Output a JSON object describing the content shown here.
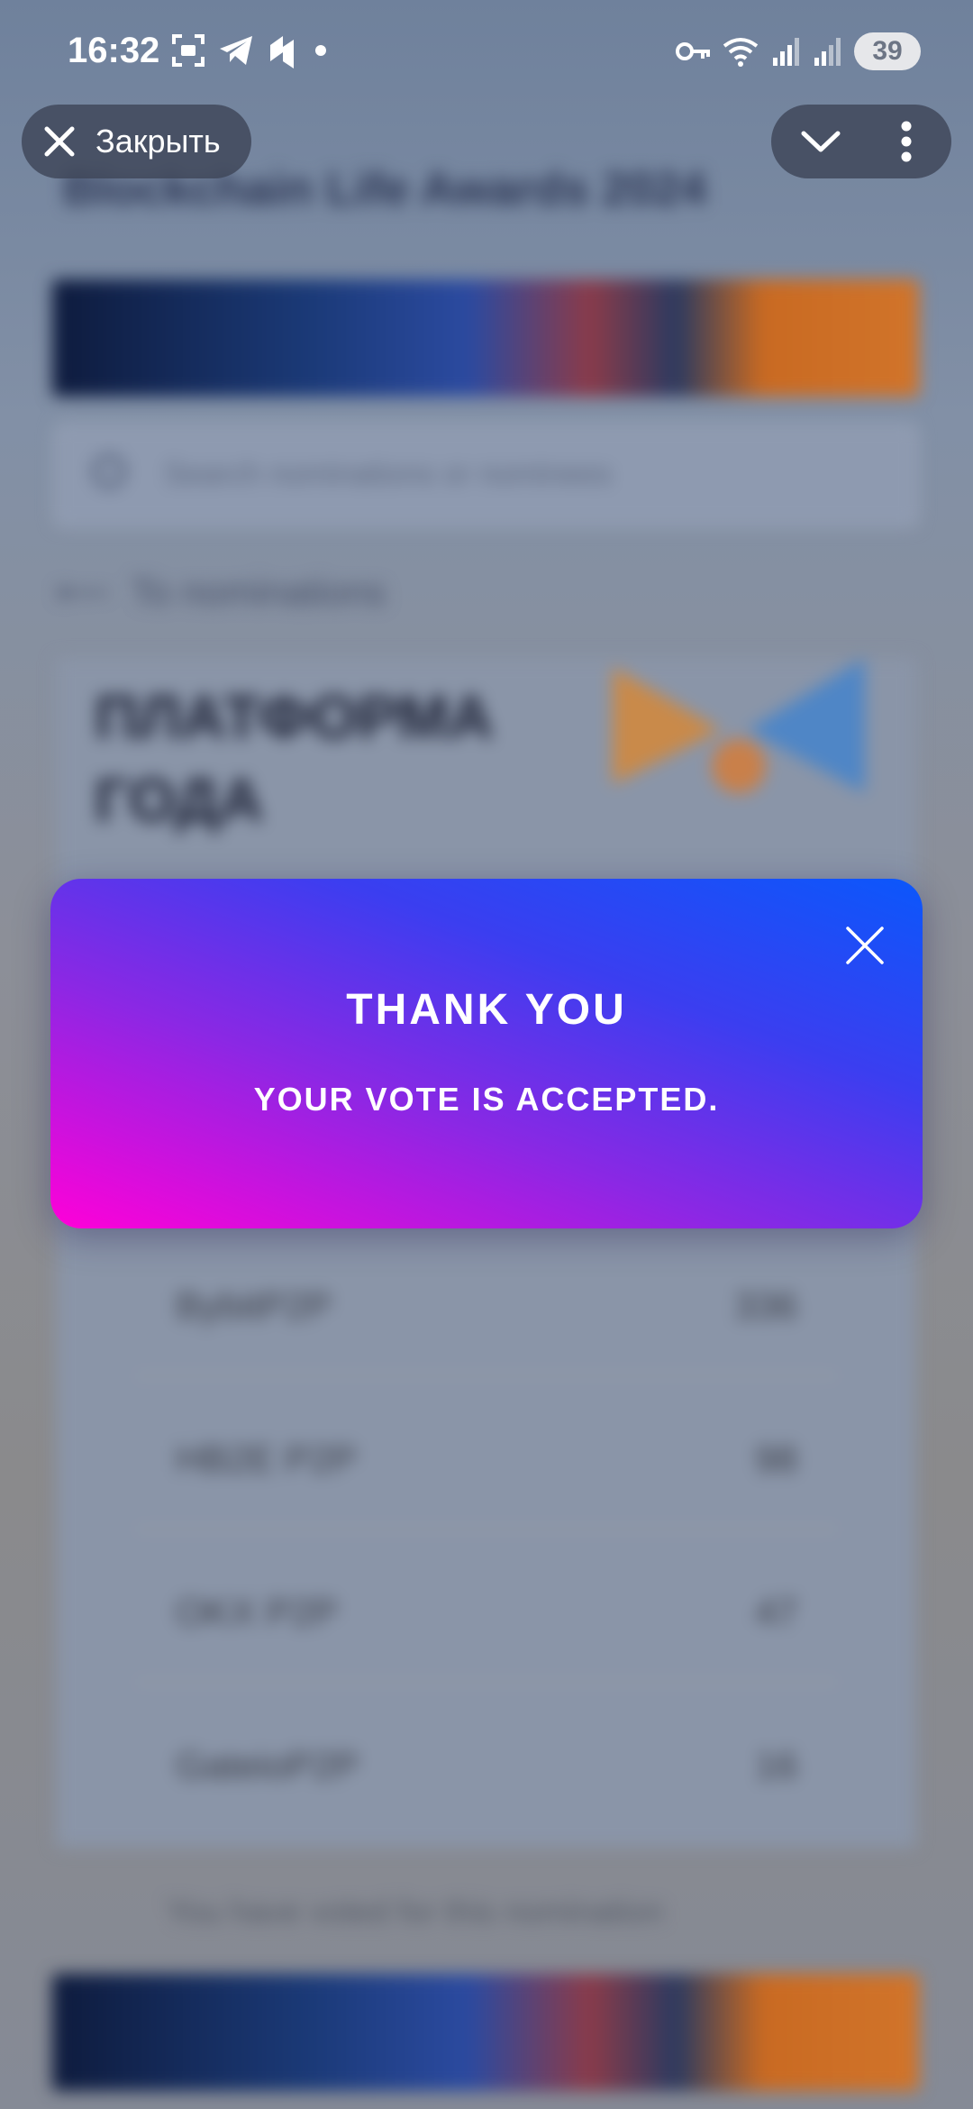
{
  "status_bar": {
    "time": "16:32",
    "battery": "39"
  },
  "browser": {
    "close_label": "Закрыть"
  },
  "modal": {
    "title": "THANK YOU",
    "subtitle": "YOUR VOTE IS ACCEPTED."
  },
  "colors": {
    "modal_gradient_start": "#ff00d8",
    "modal_gradient_end": "#0b57fb",
    "overlay_pill": "#3e4658"
  }
}
